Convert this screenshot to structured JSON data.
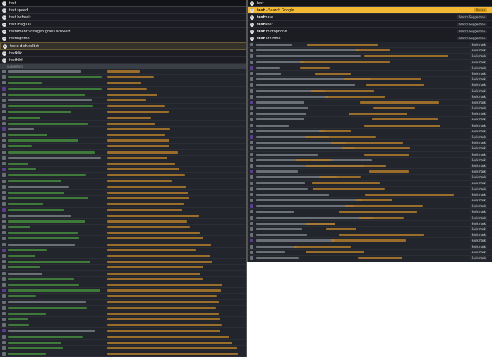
{
  "left": {
    "address": "test",
    "suggestions": [
      {
        "text": "test speed"
      },
      {
        "text": "test befreeit"
      },
      {
        "text": "test maguas"
      },
      {
        "text": "testament vorlagen gratis schweiz"
      },
      {
        "text": "testingtime"
      },
      {
        "text": "teste dich selbst",
        "highlighted": true
      },
      {
        "text": "testklik"
      },
      {
        "text": "testbild"
      }
    ],
    "section_label": "suggestion"
  },
  "right": {
    "address": "test",
    "suggestions": [
      {
        "bold": "test",
        "rest": " - Search Google",
        "tag": "Please",
        "highlighted": true
      },
      {
        "bold": "test",
        "rest": "base",
        "tag": "Search Suggestion"
      },
      {
        "bold": "test",
        "rest": "aber",
        "tag": "Search Suggestion"
      },
      {
        "bold": "test",
        "rest": " microphone",
        "tag": "Search Suggestion"
      },
      {
        "bold": "test",
        "rest": "udxrome",
        "tag": "Search Suggestion"
      }
    ],
    "bookmark_label": "Bookmark"
  },
  "colors": {
    "panel_bg": "#22252b",
    "highlight": "#f2b833",
    "history_title": "#3f7a3a",
    "url": "#b07a2a"
  },
  "icons": [
    "google-icon",
    "favicon"
  ]
}
